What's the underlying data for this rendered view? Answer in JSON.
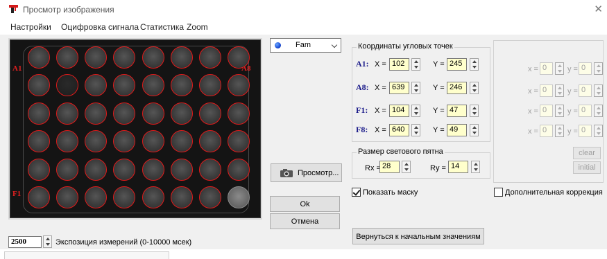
{
  "window": {
    "title": "Просмотр изображения"
  },
  "menu": [
    "Настройки",
    "Оцифровка сигнала",
    "Статистика",
    "Zoom"
  ],
  "plate": {
    "corner_labels": {
      "A1": "A1",
      "A8": "A8",
      "F1": "F1",
      "F8": "F8"
    },
    "rows": 6,
    "cols": 8,
    "well_outline_color": "#e01a1a"
  },
  "exposure": {
    "value": "2500",
    "label": "Экспозиция измерений (0-10000 мсек)"
  },
  "dye": {
    "selected": "Fam"
  },
  "buttons": {
    "preview": "Просмотр...",
    "ok": "Ok",
    "cancel": "Отмена",
    "reset": "Вернуться к начальным значениям",
    "clear": "clear",
    "initial": "initial"
  },
  "corners_group": {
    "title": "Координаты угловых точек",
    "points": [
      {
        "name": "A1:",
        "x": "102",
        "y": "245"
      },
      {
        "name": "A8:",
        "x": "639",
        "y": "246"
      },
      {
        "name": "F1:",
        "x": "104",
        "y": "47"
      },
      {
        "name": "F8:",
        "x": "640",
        "y": "49"
      }
    ],
    "x_label": "X =",
    "y_label": "Y ="
  },
  "spot_group": {
    "title": "Размер светового пятна",
    "rx_label": "Rx =",
    "rx": "28",
    "ry_label": "Ry =",
    "ry": "14"
  },
  "show_mask": {
    "label": "Показать маску",
    "checked": true
  },
  "extra_correction": {
    "label": "Дополнительная коррекция",
    "checked": false,
    "x_label": "x =",
    "y_label": "y =",
    "rows": [
      {
        "x": "0",
        "y": "0"
      },
      {
        "x": "0",
        "y": "0"
      },
      {
        "x": "0",
        "y": "0"
      },
      {
        "x": "0",
        "y": "0"
      }
    ]
  }
}
